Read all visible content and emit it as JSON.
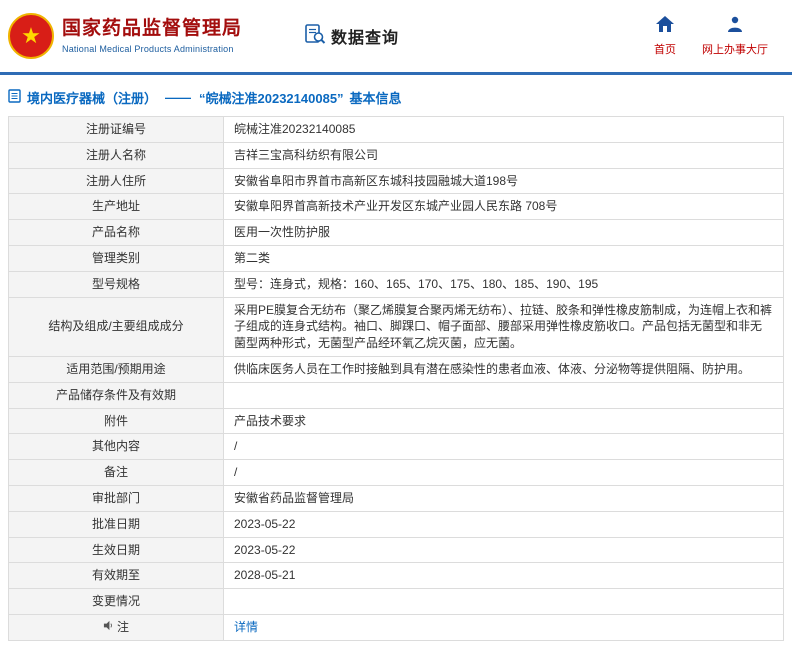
{
  "header": {
    "title": "国家药品监督管理局",
    "subtitle": "National Medical Products Administration",
    "query_label": "数据查询",
    "nav": [
      {
        "label": "首页",
        "icon": "home-icon"
      },
      {
        "label": "网上办事大厅",
        "icon": "person-icon"
      }
    ]
  },
  "breadcrumb": {
    "section": "境内医疗器械（注册）",
    "separator": "——",
    "registration": "“皖械注准20232140085”",
    "suffix": "基本信息"
  },
  "table": {
    "rows": [
      {
        "label": "注册证编号",
        "value": "皖械注准20232140085"
      },
      {
        "label": "注册人名称",
        "value": "吉祥三宝高科纺织有限公司"
      },
      {
        "label": "注册人住所",
        "value": "安徽省阜阳市界首市高新区东城科技园融城大道198号"
      },
      {
        "label": "生产地址",
        "value": "安徽阜阳界首高新技术产业开发区东城产业园人民东路 708号"
      },
      {
        "label": "产品名称",
        "value": "医用一次性防护服"
      },
      {
        "label": "管理类别",
        "value": "第二类"
      },
      {
        "label": "型号规格",
        "value": "型号：连身式，规格：160、165、170、175、180、185、190、195"
      },
      {
        "label": "结构及组成/主要组成成分",
        "value": "采用PE膜复合无纺布（聚乙烯膜复合聚丙烯无纺布）、拉链、胶条和弹性橡皮筋制成，为连帽上衣和裤子组成的连身式结构。袖口、脚踝口、帽子面部、腰部采用弹性橡皮筋收口。产品包括无菌型和非无菌型两种形式，无菌型产品经环氧乙烷灭菌，应无菌。"
      },
      {
        "label": "适用范围/预期用途",
        "value": "供临床医务人员在工作时接触到具有潜在感染性的患者血液、体液、分泌物等提供阻隔、防护用。"
      },
      {
        "label": "产品储存条件及有效期",
        "value": ""
      },
      {
        "label": "附件",
        "value": "产品技术要求"
      },
      {
        "label": "其他内容",
        "value": "/"
      },
      {
        "label": "备注",
        "value": "/"
      },
      {
        "label": "审批部门",
        "value": "安徽省药品监督管理局"
      },
      {
        "label": "批准日期",
        "value": "2023-05-22"
      },
      {
        "label": "生效日期",
        "value": "2023-05-22"
      },
      {
        "label": "有效期至",
        "value": "2028-05-21"
      },
      {
        "label": "变更情况",
        "value": ""
      },
      {
        "label": "注",
        "value": "详情"
      }
    ]
  },
  "icons": {
    "emblem_star": "★",
    "emblem": "national-emblem-icon",
    "data_query": "document-search-icon",
    "home": "home-icon",
    "service_hall": "person-icon",
    "breadcrumb": "document-icon",
    "note": "speaker-icon"
  },
  "colors": {
    "header_red": "#a30d0d",
    "subtitle_blue": "#1b5c9e",
    "divider_blue": "#2e6cb5",
    "link_blue": "#0a69c0",
    "nav_red": "#c00000"
  }
}
